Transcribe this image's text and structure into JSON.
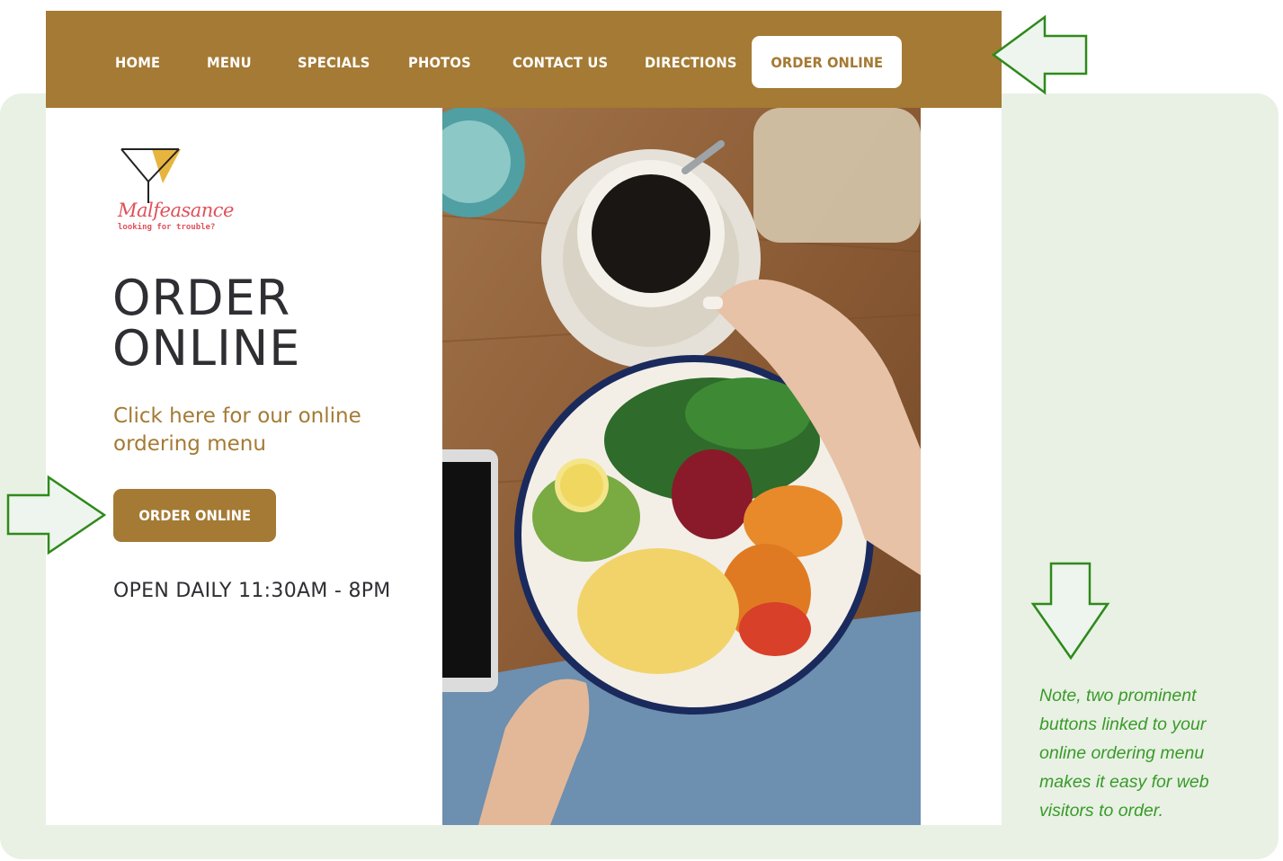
{
  "nav": {
    "items": [
      "HOME",
      "MENU",
      "SPECIALS",
      "PHOTOS",
      "CONTACT US",
      "DIRECTIONS"
    ],
    "cta_label": "ORDER ONLINE"
  },
  "brand": {
    "name": "Malfeasance",
    "tagline": "looking for trouble?"
  },
  "hero": {
    "title_line1": "ORDER",
    "title_line2": "ONLINE",
    "subtitle_line1": "Click here for our online",
    "subtitle_line2": "ordering menu",
    "button_label": "ORDER ONLINE",
    "hours": "OPEN DAILY 11:30AM - 8PM"
  },
  "note": {
    "text": "Note, two prominent buttons linked to your online ordering menu makes it easy for web visitors to order."
  },
  "colors": {
    "brand_brown": "#a47a34",
    "note_green": "#3a9a2a",
    "panel_green": "#e8f1e4",
    "logo_pink": "#e0505a"
  },
  "icons": [
    "cocktail-glass-icon",
    "arrow-left-icon",
    "arrow-right-icon",
    "arrow-down-icon"
  ]
}
